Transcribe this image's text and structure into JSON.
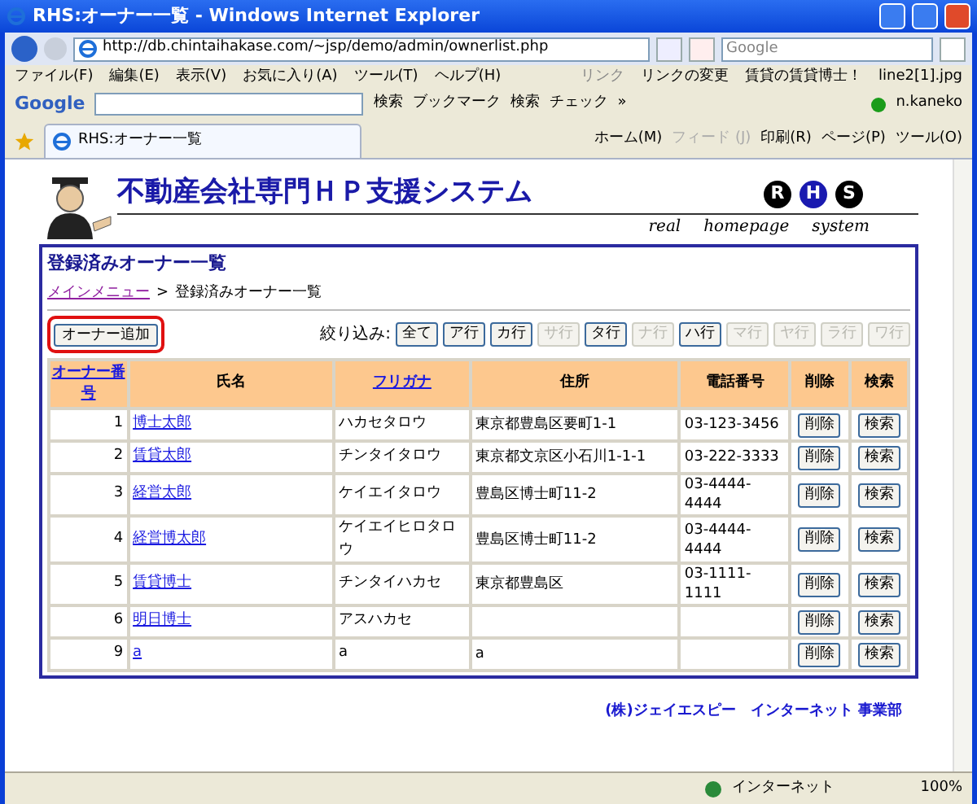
{
  "window": {
    "title": "RHS:オーナー一覧 - Windows Internet Explorer"
  },
  "address_bar": {
    "url": "http://db.chintaihakase.com/~jsp/demo/admin/ownerlist.php"
  },
  "search_field": {
    "placeholder": "Google"
  },
  "menu": [
    "ファイル(F)",
    "編集(E)",
    "表示(V)",
    "お気に入り(A)",
    "ツール(T)",
    "ヘルプ(H)"
  ],
  "links": {
    "label": "リンク",
    "items": [
      "リンクの変更",
      "賃貸の賃貸博士！",
      "line2[1].jpg"
    ]
  },
  "google_toolbar": {
    "logo": "Google",
    "items": [
      "検索",
      "ブックマーク",
      "検索",
      "チェック",
      "»"
    ],
    "user": "n.kaneko"
  },
  "tab": {
    "title": "RHS:オーナー一覧"
  },
  "command_bar": [
    {
      "label": "ホーム(M)",
      "disabled": false
    },
    {
      "label": "フィード (J)",
      "disabled": true
    },
    {
      "label": "印刷(R)",
      "disabled": false
    },
    {
      "label": "ページ(P)",
      "disabled": false
    },
    {
      "label": "ツール(O)",
      "disabled": false
    }
  ],
  "page": {
    "site_title": "不動産会社専門ＨＰ支援システム",
    "logo_letters": [
      "R",
      "H",
      "S"
    ],
    "tagline": [
      "real",
      "homepage",
      "system"
    ],
    "heading": "登録済みオーナー一覧",
    "breadcrumb": {
      "link": "メインメニュー",
      "separator": ">",
      "current": "登録済みオーナー一覧"
    },
    "add_button": {
      "label": "オーナー追加",
      "highlighted": true
    },
    "filter": {
      "label": "絞り込み:",
      "buttons": [
        {
          "label": "全て",
          "disabled": false
        },
        {
          "label": "ア行",
          "disabled": false
        },
        {
          "label": "カ行",
          "disabled": false
        },
        {
          "label": "サ行",
          "disabled": true
        },
        {
          "label": "タ行",
          "disabled": false
        },
        {
          "label": "ナ行",
          "disabled": true
        },
        {
          "label": "ハ行",
          "disabled": false
        },
        {
          "label": "マ行",
          "disabled": true
        },
        {
          "label": "ヤ行",
          "disabled": true
        },
        {
          "label": "ラ行",
          "disabled": true
        },
        {
          "label": "ワ行",
          "disabled": true
        }
      ]
    },
    "table": {
      "columns": [
        {
          "label": "オーナー番号",
          "link": true
        },
        {
          "label": "氏名",
          "link": false
        },
        {
          "label": "フリガナ",
          "link": true
        },
        {
          "label": "住所",
          "link": false
        },
        {
          "label": "電話番号",
          "link": false
        },
        {
          "label": "削除",
          "link": false
        },
        {
          "label": "検索",
          "link": false
        }
      ],
      "rows": [
        {
          "no": "1",
          "name": "博士太郎",
          "kana": "ハカセタロウ",
          "address": "東京都豊島区要町1-1",
          "phone": "03-123-3456",
          "delete": "削除",
          "search": "検索"
        },
        {
          "no": "2",
          "name": "賃貸太郎",
          "kana": "チンタイタロウ",
          "address": "東京都文京区小石川1-1-1",
          "phone": "03-222-3333",
          "delete": "削除",
          "search": "検索"
        },
        {
          "no": "3",
          "name": "経営太郎",
          "kana": "ケイエイタロウ",
          "address": "豊島区博士町11-2",
          "phone": "03-4444-4444",
          "delete": "削除",
          "search": "検索"
        },
        {
          "no": "4",
          "name": "経営博太郎",
          "kana": "ケイエイヒロタロウ",
          "address": "豊島区博士町11-2",
          "phone": "03-4444-4444",
          "delete": "削除",
          "search": "検索"
        },
        {
          "no": "5",
          "name": "賃貸博士",
          "kana": "チンタイハカセ",
          "address": "東京都豊島区",
          "phone": "03-1111-1111",
          "delete": "削除",
          "search": "検索"
        },
        {
          "no": "6",
          "name": "明日博士",
          "kana": "アスハカセ",
          "address": "",
          "phone": "",
          "delete": "削除",
          "search": "検索"
        },
        {
          "no": "9",
          "name": "a",
          "kana": "a",
          "address": "a",
          "phone": "",
          "delete": "削除",
          "search": "検索"
        }
      ]
    },
    "footer": "(株)ジェイエスピー　インターネット 事業部"
  },
  "status_bar": {
    "zone": "インターネット",
    "zoom": "100%"
  }
}
